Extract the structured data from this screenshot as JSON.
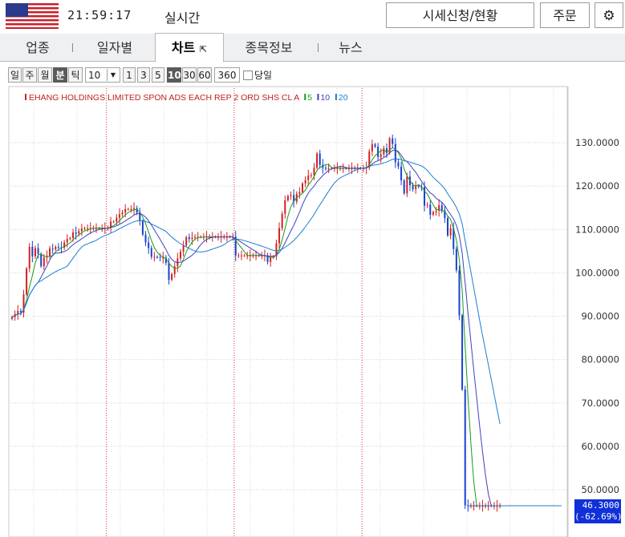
{
  "header": {
    "time": "21:59:17",
    "mode": "실시간",
    "quote_button": "시세신청/현황",
    "order_button": "주문",
    "settings_icon": "gear-icon",
    "flag_icon": "us-flag-icon"
  },
  "tabs": [
    {
      "label": "업종"
    },
    {
      "label": "일자별"
    },
    {
      "label": "차트"
    },
    {
      "label": "종목정보"
    },
    {
      "label": "뉴스"
    }
  ],
  "controls": {
    "periods": [
      "일",
      "주",
      "월",
      "분",
      "틱"
    ],
    "active_period": "분",
    "interval_value": "10",
    "interval_buttons": [
      "1",
      "3",
      "5",
      "10",
      "30",
      "60"
    ],
    "active_interval": "10",
    "count_value": "360",
    "today_label": "당일"
  },
  "chart_data": {
    "type": "candlestick",
    "title": "EHANG HOLDINGS LIMITED SPON ADS EACH REP 2 ORD SHS CL A",
    "moving_averages": [
      {
        "name": "5",
        "color": "#1a9a1a"
      },
      {
        "name": "10",
        "color": "#4040c0"
      },
      {
        "name": "20",
        "color": "#1a7fd0"
      }
    ],
    "ylim": [
      42,
      141
    ],
    "yticks": [
      50,
      60,
      70,
      80,
      90,
      100,
      110,
      120,
      130
    ],
    "ytick_labels": [
      "50.0000",
      "60.0000",
      "70.0000",
      "80.0000",
      "90.0000",
      "100.0000",
      "110.0000",
      "120.0000",
      "130.0000"
    ],
    "last_price": "46.3000",
    "last_change": "(-62.69%)",
    "colors": {
      "up": "#d42020",
      "down": "#1a40d0",
      "session_line": "#d83030",
      "label_box": "#1030d8"
    },
    "close": [
      89.8,
      90.5,
      91.2,
      90.8,
      95,
      101,
      106,
      103.8,
      105.7,
      104.4,
      101.5,
      103.5,
      103.8,
      105.6,
      105.4,
      106,
      105.9,
      105.8,
      107,
      107.8,
      108,
      109.3,
      109,
      109.6,
      110.2,
      110.3,
      110.3,
      110.3,
      110.3,
      110.3,
      110.3,
      110.3,
      110.3,
      110.3,
      111.8,
      111.8,
      112.7,
      113.5,
      113.9,
      114.7,
      114.7,
      114.7,
      114.9,
      113.9,
      112,
      108.8,
      107,
      105.7,
      103.7,
      103.7,
      103.6,
      103.5,
      103.5,
      102.3,
      98.4,
      99.7,
      101.5,
      103.3,
      104.9,
      106.3,
      108.2,
      107.8,
      108.1,
      108.3,
      108.3,
      108.3,
      108.3,
      108.3,
      108.3,
      108.3,
      108.3,
      108.3,
      108.3,
      108.3,
      108.3,
      108.3,
      108.3,
      104,
      104,
      104,
      104,
      104,
      104,
      104,
      104,
      104,
      104,
      104,
      102.5,
      103.5,
      103.8,
      106.8,
      110.3,
      113.6,
      116.7,
      117.7,
      117.9,
      116.4,
      118.2,
      118.6,
      120.6,
      121.4,
      122.4,
      122.5,
      124.2,
      127.5,
      124.9,
      124.2,
      124.1,
      124.1,
      124.1,
      124.1,
      124.1,
      124.1,
      124.1,
      124.1,
      124.1,
      124.1,
      124.1,
      124.1,
      124.1,
      124.1,
      124.3,
      128,
      129.6,
      129.1,
      126.7,
      127.3,
      128.7,
      127.6,
      131,
      129.7,
      125.5,
      124.5,
      121.3,
      118.3,
      122.2,
      120.2,
      119.3,
      120.1,
      119.8,
      119.7,
      115.5,
      115.7,
      113.4,
      114,
      114.3,
      115.6,
      114.4,
      112.6,
      108.6,
      110.3,
      105.5,
      100.6,
      90.2,
      73.1,
      46.4,
      46.3,
      46.3,
      46.3,
      46.3,
      46.3,
      46.3,
      46.3,
      46.3,
      46.3,
      46.3,
      46.3,
      46.3
    ],
    "session_breaks_candle_index": [
      32,
      76,
      120
    ]
  }
}
